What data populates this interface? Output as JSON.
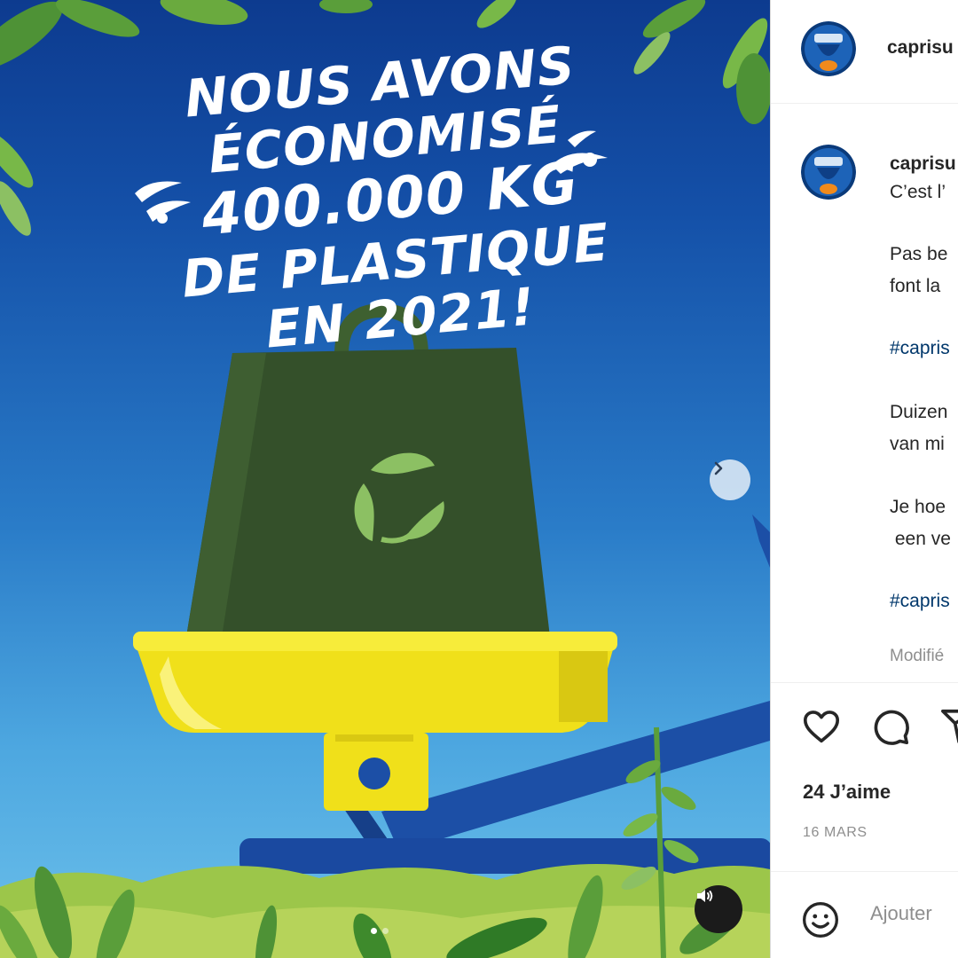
{
  "post": {
    "headline": [
      "NOUS AVONS ÉCONOMISÉ",
      "400.000 KG",
      "DE PLASTIQUE",
      "EN 2021!"
    ],
    "carousel": {
      "slide_index": 1,
      "slide_count": 2
    }
  },
  "sidebar": {
    "username": "caprisu",
    "caption_username": "caprisu",
    "caption_lines": [
      "C’est l’",
      "Pas be",
      "font la",
      "#capris",
      "Duizen",
      "van mi",
      "Je hoe",
      " een ve",
      "#capris"
    ],
    "edited": "Modifié",
    "likes": "24 J’aime",
    "date": "16 MARS",
    "comment_placeholder": "Ajouter"
  },
  "icons": {
    "like": "heart-icon",
    "comment": "comment-bubble-icon",
    "share": "paper-plane-icon",
    "emoji": "smiley-icon",
    "next": "chevron-right-icon",
    "sound": "speaker-icon"
  },
  "colors": {
    "sky_top": "#0d3b8f",
    "sky_bottom": "#6cc0ea",
    "weight": "#34502a",
    "scale_pan": "#f0e01a",
    "scale_arm": "#1c4fa6",
    "leaf": "#5a9e3a",
    "hashtag": "#00376b"
  }
}
